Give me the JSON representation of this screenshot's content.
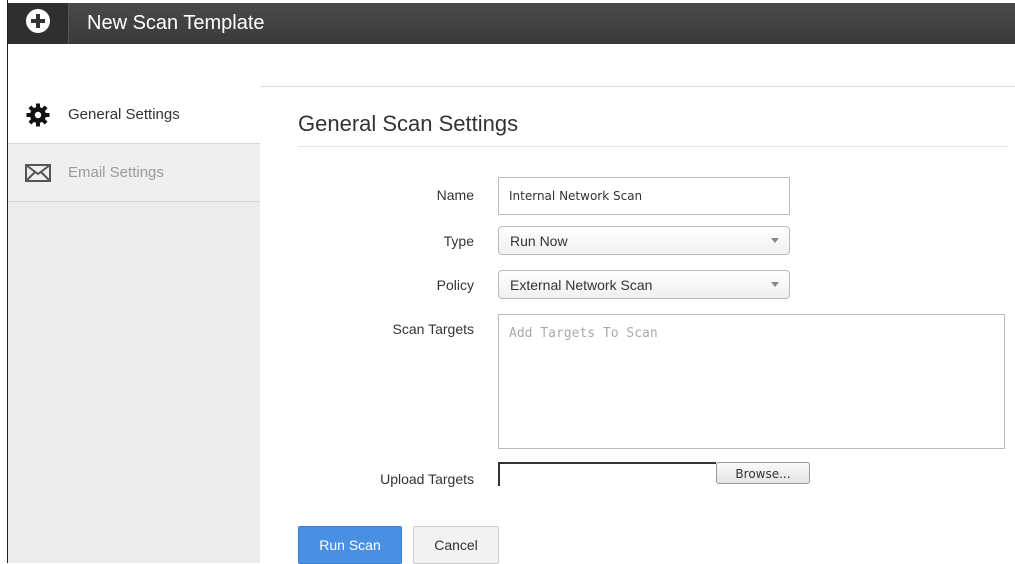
{
  "header": {
    "title": "New Scan Template",
    "icon": "plus-circle-icon"
  },
  "sidebar": {
    "items": [
      {
        "label": "General Settings",
        "icon": "gear-icon",
        "active": true
      },
      {
        "label": "Email Settings",
        "icon": "envelope-icon",
        "active": false
      }
    ]
  },
  "main": {
    "section_title": "General Scan Settings",
    "fields": {
      "name": {
        "label": "Name",
        "value": "Internal Network Scan"
      },
      "type": {
        "label": "Type",
        "value": "Run Now"
      },
      "policy": {
        "label": "Policy",
        "value": "External Network Scan"
      },
      "scan_targets": {
        "label": "Scan Targets",
        "placeholder": "Add Targets To Scan"
      },
      "upload_targets": {
        "label": "Upload Targets",
        "browse_label": "Browse..."
      }
    },
    "buttons": {
      "run_label": "Run Scan",
      "cancel_label": "Cancel"
    }
  },
  "colors": {
    "primary": "#4a90e2",
    "topbar": "#424242",
    "sidebar": "#ececec"
  }
}
